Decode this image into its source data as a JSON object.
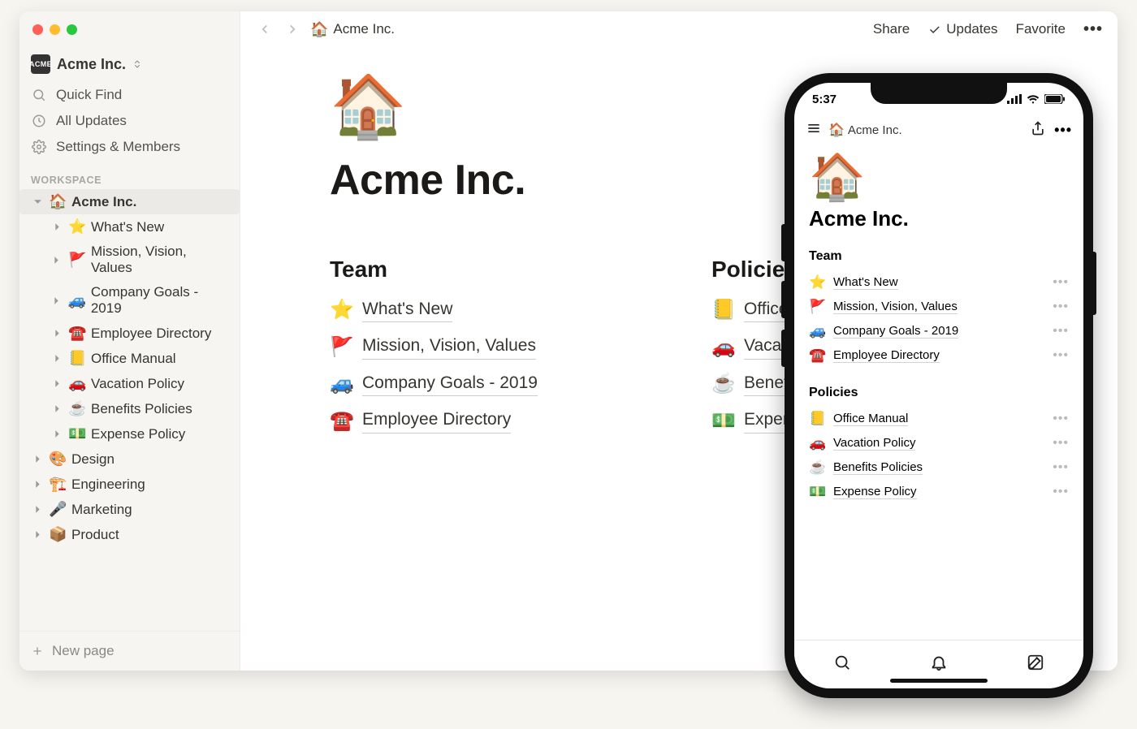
{
  "workspace": {
    "name": "Acme Inc.",
    "badge_text": "ACME"
  },
  "sidebar": {
    "quick_find": "Quick Find",
    "all_updates": "All Updates",
    "settings": "Settings & Members",
    "section_label": "WORKSPACE",
    "new_page": "New page",
    "root": {
      "emoji": "🏠",
      "label": "Acme Inc."
    },
    "children": [
      {
        "emoji": "⭐",
        "label": "What's New"
      },
      {
        "emoji": "🚩",
        "label": "Mission, Vision, Values"
      },
      {
        "emoji": "🚙",
        "label": "Company Goals - 2019"
      },
      {
        "emoji": "☎️",
        "label": "Employee Directory"
      },
      {
        "emoji": "📒",
        "label": "Office Manual"
      },
      {
        "emoji": "🚗",
        "label": "Vacation Policy"
      },
      {
        "emoji": "☕",
        "label": "Benefits Policies"
      },
      {
        "emoji": "💵",
        "label": "Expense Policy"
      }
    ],
    "siblings": [
      {
        "emoji": "🎨",
        "label": "Design"
      },
      {
        "emoji": "🏗️",
        "label": "Engineering"
      },
      {
        "emoji": "🎤",
        "label": "Marketing"
      },
      {
        "emoji": "📦",
        "label": "Product"
      }
    ]
  },
  "topbar": {
    "crumb_emoji": "🏠",
    "crumb_label": "Acme Inc.",
    "share": "Share",
    "updates": "Updates",
    "favorite": "Favorite"
  },
  "page": {
    "icon": "🏠",
    "title": "Acme Inc.",
    "columns": [
      {
        "heading": "Team",
        "links": [
          {
            "emoji": "⭐",
            "label": "What's New"
          },
          {
            "emoji": "🚩",
            "label": "Mission, Vision, Values"
          },
          {
            "emoji": "🚙",
            "label": "Company Goals - 2019"
          },
          {
            "emoji": "☎️",
            "label": "Employee Directory"
          }
        ]
      },
      {
        "heading": "Policies",
        "links": [
          {
            "emoji": "📒",
            "label": "Office Manual"
          },
          {
            "emoji": "🚗",
            "label": "Vacation Policy"
          },
          {
            "emoji": "☕",
            "label": "Benefits Policies"
          },
          {
            "emoji": "💵",
            "label": "Expense Policy"
          }
        ]
      }
    ]
  },
  "phone": {
    "time": "5:37",
    "crumb_emoji": "🏠",
    "crumb_label": "Acme Inc.",
    "icon": "🏠",
    "title": "Acme Inc.",
    "sections": [
      {
        "heading": "Team",
        "links": [
          {
            "emoji": "⭐",
            "label": "What's New"
          },
          {
            "emoji": "🚩",
            "label": "Mission, Vision, Values"
          },
          {
            "emoji": "🚙",
            "label": "Company Goals - 2019"
          },
          {
            "emoji": "☎️",
            "label": "Employee Directory"
          }
        ]
      },
      {
        "heading": "Policies",
        "links": [
          {
            "emoji": "📒",
            "label": "Office Manual"
          },
          {
            "emoji": "🚗",
            "label": "Vacation Policy"
          },
          {
            "emoji": "☕",
            "label": "Benefits Policies"
          },
          {
            "emoji": "💵",
            "label": "Expense Policy"
          }
        ]
      }
    ]
  }
}
